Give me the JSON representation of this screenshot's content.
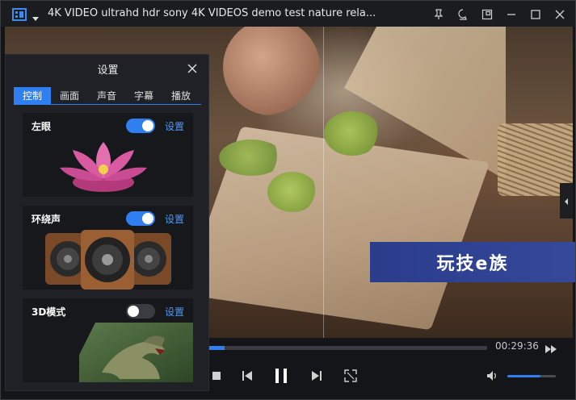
{
  "window": {
    "title": "4K VIDEO ultrahd hdr sony 4K VIDEOS demo test nature rela...",
    "accent": "#2f7ff0"
  },
  "titlebar_icons": [
    "app-menu-icon",
    "pin-icon",
    "skin-icon",
    "mini-mode-icon",
    "minimize-icon",
    "maximize-icon",
    "close-icon"
  ],
  "video": {
    "watermark": "玩技e族"
  },
  "player": {
    "time": "00:29:36",
    "progress": 0.055,
    "volume": 0.68
  },
  "settings": {
    "title": "设置",
    "tabs": [
      {
        "label": "控制",
        "active": true
      },
      {
        "label": "画面",
        "active": false
      },
      {
        "label": "声音",
        "active": false
      },
      {
        "label": "字幕",
        "active": false
      },
      {
        "label": "播放",
        "active": false
      }
    ],
    "cards": [
      {
        "label": "左眼",
        "enabled": true,
        "link": "设置",
        "art": "lotus-icon"
      },
      {
        "label": "环绕声",
        "enabled": true,
        "link": "设置",
        "art": "speakers-icon"
      },
      {
        "label": "3D模式",
        "enabled": false,
        "link": "设置",
        "art": "dinosaur-icon"
      }
    ]
  }
}
